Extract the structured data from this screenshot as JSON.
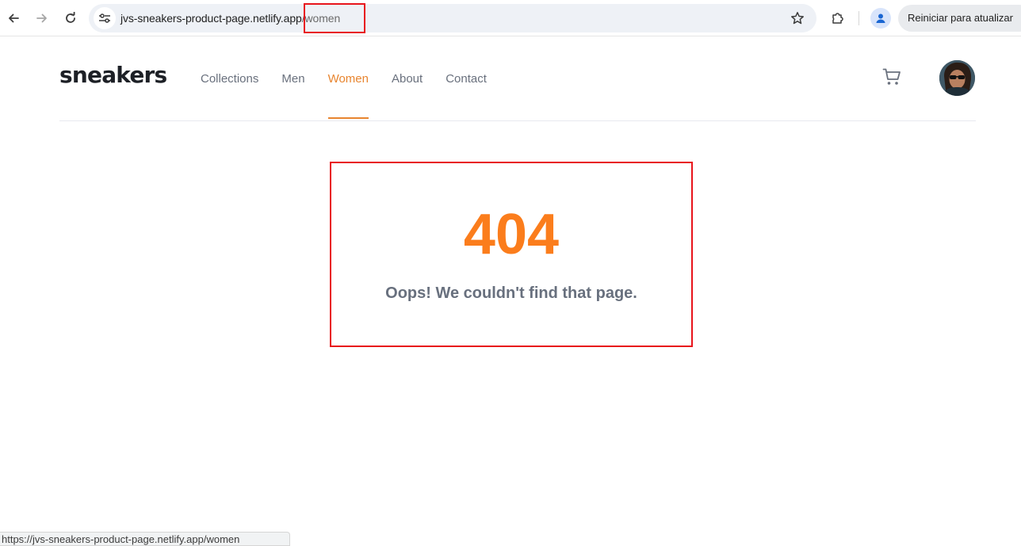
{
  "browser": {
    "url_host": "jvs-sneakers-product-page.netlify.app",
    "url_path": "/women",
    "update_button_label": "Reiniciar para atualizar",
    "status_url": "https://jvs-sneakers-product-page.netlify.app/women",
    "icons": {
      "back": "back-arrow-icon",
      "forward": "forward-arrow-icon",
      "reload": "reload-icon",
      "site_info": "tune-icon",
      "bookmark": "star-icon",
      "extensions": "puzzle-icon",
      "profile": "profile-icon"
    }
  },
  "site": {
    "logo": "sneakers",
    "nav": [
      {
        "label": "Collections"
      },
      {
        "label": "Men"
      },
      {
        "label": "Women"
      },
      {
        "label": "About"
      },
      {
        "label": "Contact"
      }
    ],
    "active_nav": "Women",
    "icons": {
      "cart": "cart-icon",
      "avatar": "avatar"
    }
  },
  "error": {
    "code": "404",
    "message": "Oops! We couldn't find that page."
  },
  "colors": {
    "accent": "#fb7d1c",
    "nav_active": "#e8852f",
    "text_dark": "#1d2026",
    "text_muted": "#69707d",
    "highlight": "#e8141b"
  }
}
